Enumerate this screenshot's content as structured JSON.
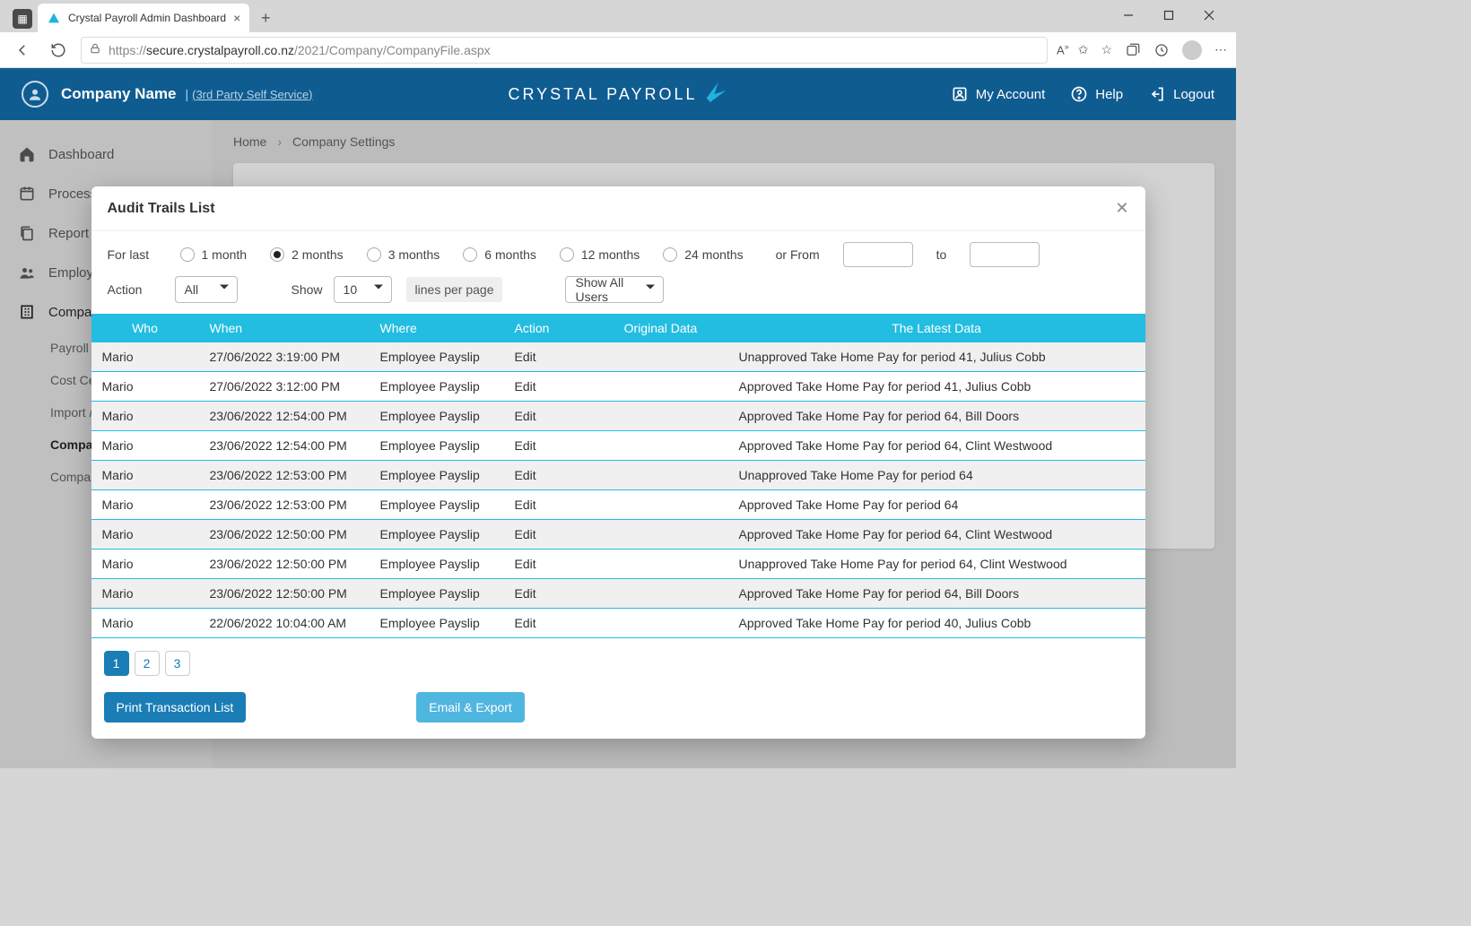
{
  "browser": {
    "tab_title": "Crystal Payroll Admin Dashboard",
    "url_proto": "https://",
    "url_host": "secure.crystalpayroll.co.nz",
    "url_path": "/2021/Company/CompanyFile.aspx"
  },
  "header": {
    "company_name": "Company Name",
    "self_service": "(3rd Party Self Service)",
    "brand": "CRYSTAL PAYROLL",
    "my_account": "My Account",
    "help": "Help",
    "logout": "Logout"
  },
  "sidebar": {
    "items": [
      {
        "label": "Dashboard"
      },
      {
        "label": "Process a Pay"
      },
      {
        "label": "Report Ce"
      },
      {
        "label": "Employee"
      },
      {
        "label": "Company"
      }
    ],
    "subitems": [
      {
        "label": "Payroll S"
      },
      {
        "label": "Cost Ce"
      },
      {
        "label": "Import /"
      },
      {
        "label": "Compan",
        "active": true
      },
      {
        "label": "Compan"
      }
    ]
  },
  "breadcrumb": {
    "home": "Home",
    "page": "Company Settings"
  },
  "modal": {
    "title": "Audit Trails List",
    "for_last_label": "For last",
    "periods": [
      "1 month",
      "2 months",
      "3 months",
      "6 months",
      "12 months",
      "24 months"
    ],
    "selected_period": "2 months",
    "or_from": "or From",
    "to": "to",
    "action_label": "Action",
    "action_value": "All",
    "show_label": "Show",
    "lines_value": "10",
    "lines_per_page": "lines per page",
    "users_value": "Show All Users",
    "columns": [
      "Who",
      "When",
      "Where",
      "Action",
      "Original Data",
      "The Latest Data"
    ],
    "rows": [
      {
        "who": "Mario",
        "when": "27/06/2022 3:19:00 PM",
        "where": "Employee Payslip",
        "action": "Edit",
        "orig": "",
        "latest": "Unapproved Take Home Pay for period 41, Julius Cobb"
      },
      {
        "who": "Mario",
        "when": "27/06/2022 3:12:00 PM",
        "where": "Employee Payslip",
        "action": "Edit",
        "orig": "",
        "latest": "Approved Take Home Pay for period 41, Julius Cobb"
      },
      {
        "who": "Mario",
        "when": "23/06/2022 12:54:00 PM",
        "where": "Employee Payslip",
        "action": "Edit",
        "orig": "",
        "latest": "Approved Take Home Pay for period 64, Bill Doors"
      },
      {
        "who": "Mario",
        "when": "23/06/2022 12:54:00 PM",
        "where": "Employee Payslip",
        "action": "Edit",
        "orig": "",
        "latest": "Approved Take Home Pay for period 64, Clint Westwood"
      },
      {
        "who": "Mario",
        "when": "23/06/2022 12:53:00 PM",
        "where": "Employee Payslip",
        "action": "Edit",
        "orig": "",
        "latest": "Unapproved Take Home Pay for period 64"
      },
      {
        "who": "Mario",
        "when": "23/06/2022 12:53:00 PM",
        "where": "Employee Payslip",
        "action": "Edit",
        "orig": "",
        "latest": "Approved Take Home Pay for period 64"
      },
      {
        "who": "Mario",
        "when": "23/06/2022 12:50:00 PM",
        "where": "Employee Payslip",
        "action": "Edit",
        "orig": "",
        "latest": "Approved Take Home Pay for period 64, Clint Westwood"
      },
      {
        "who": "Mario",
        "when": "23/06/2022 12:50:00 PM",
        "where": "Employee Payslip",
        "action": "Edit",
        "orig": "",
        "latest": "Unapproved Take Home Pay for period 64, Clint Westwood"
      },
      {
        "who": "Mario",
        "when": "23/06/2022 12:50:00 PM",
        "where": "Employee Payslip",
        "action": "Edit",
        "orig": "",
        "latest": "Approved Take Home Pay for period 64, Bill Doors"
      },
      {
        "who": "Mario",
        "when": "22/06/2022 10:04:00 AM",
        "where": "Employee Payslip",
        "action": "Edit",
        "orig": "",
        "latest": "Approved Take Home Pay for period 40, Julius Cobb"
      }
    ],
    "pages": [
      "1",
      "2",
      "3"
    ],
    "current_page": "1",
    "print_btn": "Print Transaction List",
    "export_btn": "Email & Export"
  }
}
